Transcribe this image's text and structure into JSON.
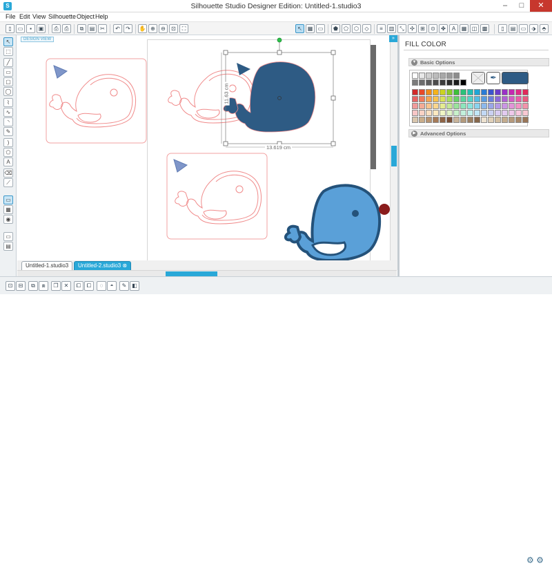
{
  "window": {
    "title": "Silhouette Studio Designer Edition: Untitled-1.studio3",
    "minimize": "–",
    "maximize": "□",
    "close": "✕"
  },
  "menu": [
    "File",
    "Edit",
    "View",
    "Silhouette",
    "Object",
    "Help"
  ],
  "toolbar_icons": [
    "new-icon",
    "open-icon",
    "save-icon",
    "save-as-icon",
    "print-icon",
    "print-cut-icon",
    "cut-icon",
    "copy-icon",
    "paste-icon",
    "undo-icon",
    "redo-icon",
    "pan-icon",
    "zoom-in-icon",
    "zoom-out-icon",
    "zoom-box-icon",
    "zoom-drag-icon",
    "fit-page-icon",
    "select-mode-icon",
    "grid-icon",
    "fill-color-icon",
    "line-color-icon",
    "line-style-icon",
    "gradient-icon",
    "pattern-icon",
    "offset-icon",
    "align-icon",
    "transform-icon",
    "replicate-icon",
    "modify-icon",
    "knife-icon",
    "library-icon",
    "store-icon",
    "cut-settings-icon",
    "send-to-silhouette-icon"
  ],
  "left_tools": [
    "select-icon",
    "point-edit-icon",
    "line-tool-icon",
    "rectangle-tool-icon",
    "rounded-rect-tool-icon",
    "ellipse-tool-icon",
    "polygon-tool-icon",
    "curve-tool-icon",
    "arc-tool-icon",
    "regular-polygon-icon",
    "freehand-tool-icon",
    "smooth-freehand-icon",
    "text-tool-icon",
    "eraser-icon",
    "knife-tool-icon",
    "view-tool-icon",
    "library-view-icon",
    "store-view-icon",
    "design-view-icon",
    "page-setup-icon"
  ],
  "canvas": {
    "design_view_tag": "DESIGN VIEW",
    "width_label": "13.619 cm",
    "height_label": "11.63 cm"
  },
  "tabs": [
    {
      "label": "Untitled-1.studio3"
    },
    {
      "label": "Untitled-2.studio3"
    }
  ],
  "panel": {
    "title": "FILL COLOR",
    "basic_label": "Basic Options",
    "advanced_label": "Advanced Options",
    "selected_color": "#2e5b84",
    "row0": [
      "#ffffff",
      "#e8e8e8",
      "#d0d0d0",
      "#bcbcbc",
      "#a8a8a8",
      "#9a9a9a",
      "#8c8c8c"
    ],
    "row1": [
      "#7c7c7c",
      "#6c6c6c",
      "#5c5c5c",
      "#4c4c4c",
      "#3c3c3c",
      "#2c2c2c",
      "#1c1c1c",
      "#000000"
    ],
    "rows": [
      [
        "#d22a2a",
        "#e84a2a",
        "#f08a1a",
        "#f4b21a",
        "#cbd321",
        "#8ecb2a",
        "#3fbf3a",
        "#2ac17a",
        "#22bfb2",
        "#1ea6d6",
        "#2a7bd6",
        "#3a54cf",
        "#6a3ccb",
        "#9a32c6",
        "#c52ab2",
        "#e02a8a",
        "#e02a5a"
      ],
      [
        "#e86464",
        "#f07a5a",
        "#f4a550",
        "#f6c24f",
        "#d9e05a",
        "#aadb60",
        "#6ad06a",
        "#5ad49e",
        "#55d2c8",
        "#54bce3",
        "#5a9ce0",
        "#6a80dc",
        "#8c6ad8",
        "#b062d4",
        "#d45cc4",
        "#ea5ca8",
        "#ea5c80"
      ],
      [
        "#f09a9a",
        "#f4ab95",
        "#f8c48e",
        "#f9d68e",
        "#e5ec92",
        "#c4e896",
        "#9ae39c",
        "#8ee5bd",
        "#8ae4dd",
        "#8ad2ee",
        "#8cb8ec",
        "#9aa6e8",
        "#b49ae6",
        "#ca96e4",
        "#e294d8",
        "#f294c4",
        "#f294aa"
      ],
      [
        "#f7c6c6",
        "#f9d2c4",
        "#fbdfc0",
        "#fce8c0",
        "#f0f5c4",
        "#dff2c6",
        "#c8f0ca",
        "#c2f0dc",
        "#c0f0ec",
        "#c0e6f6",
        "#c2d8f4",
        "#cad0f2",
        "#d8ccf2",
        "#e2caf0",
        "#eec8ea",
        "#f8c8de",
        "#f8c8d2"
      ],
      [
        "#d9c6ad",
        "#c9ad8a",
        "#b89470",
        "#a67b58",
        "#8f6446",
        "#7a5038",
        "#c8b49a",
        "#b39a7c",
        "#9c8062",
        "#86684c",
        "#ede2d0",
        "#e0d0b8",
        "#d2bea2",
        "#c4ac8e",
        "#b69a7c",
        "#a8886a",
        "#9a7658"
      ]
    ]
  },
  "bottom_icons": [
    "group-icon",
    "ungroup-icon",
    "compound-icon",
    "release-compound-icon",
    "delete-icon",
    "duplicate-icon",
    "mirror-icon",
    "bring-front-icon",
    "send-back-icon",
    "weld-icon",
    "trace-icon",
    "page-icon"
  ]
}
